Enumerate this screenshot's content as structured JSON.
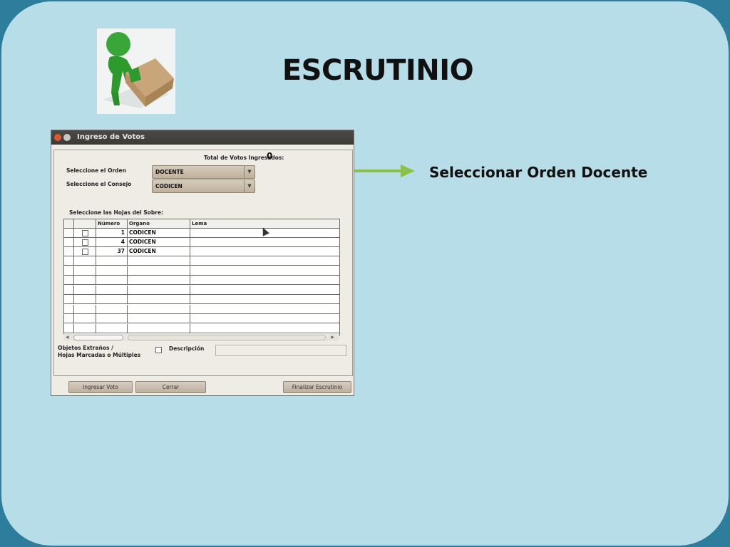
{
  "slide": {
    "title": "ESCRUTINIO",
    "callout": "Seleccionar Orden Docente",
    "arrow_color": "#8cc04a",
    "background": "#b7dde8",
    "border_color": "#2e7d9c",
    "logo_icon": "green-figure-carrying-box"
  },
  "window": {
    "title": "Ingreso de Votos",
    "total_label": "Total de Votos Ingresados:",
    "total_value": "0",
    "orden_label": "Seleccione el Orden",
    "orden_value": "DOCENTE",
    "consejo_label": "Seleccione el Consejo",
    "consejo_value": "CODICEN",
    "hojas_label": "Seleccione las Hojas del Sobre:",
    "columns": [
      "Número",
      "Organo",
      "Lema"
    ],
    "rows": [
      {
        "numero": "1",
        "organo": "CODICEN",
        "lema": ""
      },
      {
        "numero": "4",
        "organo": "CODICEN",
        "lema": ""
      },
      {
        "numero": "37",
        "organo": "CODICEN",
        "lema": ""
      }
    ],
    "objetos_label_1": "Objetos Extraños /",
    "objetos_label_2": "Hojas Marcadas o Múltiples",
    "descripcion_label": "Descripción",
    "buttons": {
      "ingresar": "Ingresar Voto",
      "cerrar": "Cerrar",
      "finalizar": "Finalizar Escrutinio"
    }
  }
}
